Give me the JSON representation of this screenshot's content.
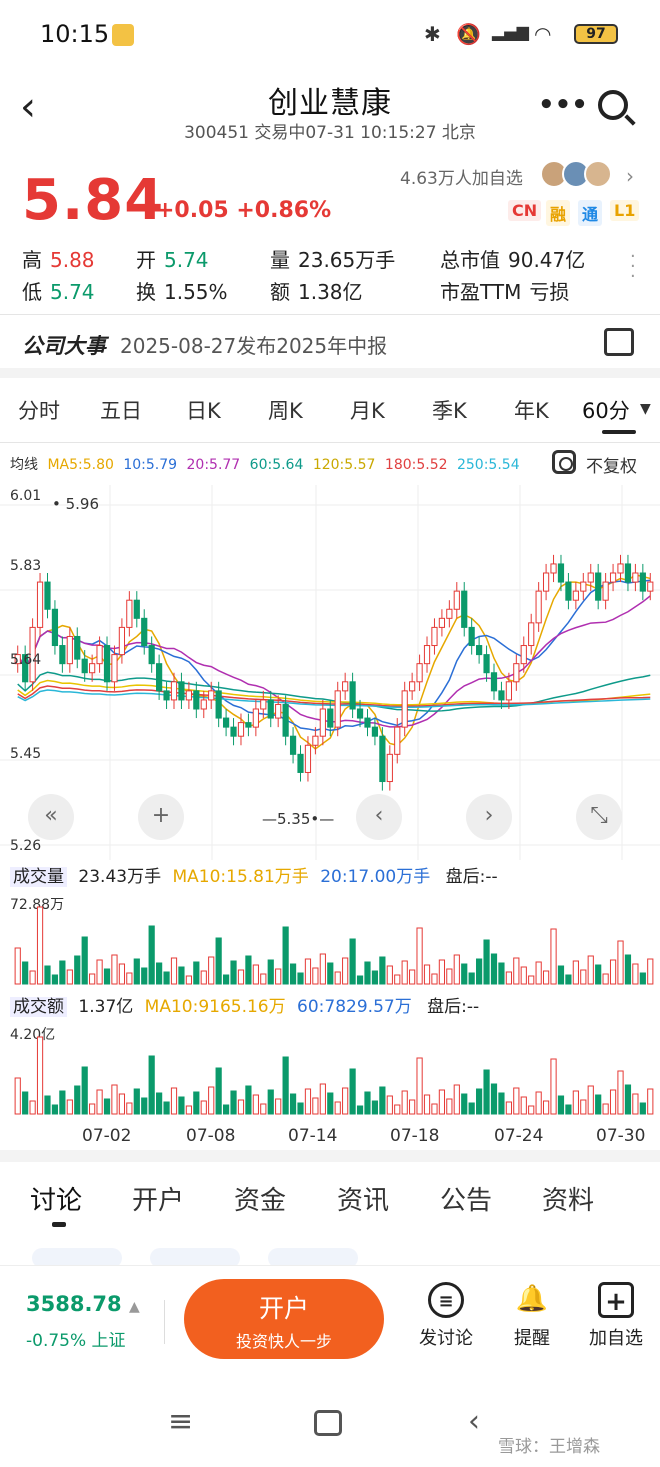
{
  "status_bar": {
    "time": "10:15",
    "battery": "97"
  },
  "header": {
    "title": "创业慧康",
    "subtitle": "300451 交易中07-31 10:15:27 北京"
  },
  "quote": {
    "price": "5.84",
    "change": "+0.05 +0.86%",
    "watch_count": "4.63万人加自选",
    "tags": [
      "CN",
      "融",
      "通",
      "L1"
    ],
    "stats": [
      {
        "label": "高",
        "value": "5.88",
        "color": "red"
      },
      {
        "label": "开",
        "value": "5.74",
        "color": "green"
      },
      {
        "label": "量",
        "value": "23.65万手",
        "color": "plain"
      },
      {
        "label": "总市值",
        "value": "90.47亿",
        "color": "plain"
      },
      {
        "label": "低",
        "value": "5.74",
        "color": "green"
      },
      {
        "label": "换",
        "value": "1.55%",
        "color": "plain"
      },
      {
        "label": "额",
        "value": "1.38亿",
        "color": "plain"
      },
      {
        "label": "市盈TTM",
        "value": "亏损",
        "color": "plain"
      }
    ]
  },
  "event": {
    "title": "公司大事",
    "text": "2025-08-27发布2025年中报"
  },
  "period_tabs": [
    "分时",
    "五日",
    "日K",
    "周K",
    "月K",
    "季K",
    "年K",
    "60分"
  ],
  "ma_legend": [
    {
      "label": "均线",
      "color": "#333333"
    },
    {
      "label": "MA5:5.80",
      "color": "#e6a800"
    },
    {
      "label": "10:5.79",
      "color": "#2b6fd6"
    },
    {
      "label": "20:5.77",
      "color": "#b02fb0"
    },
    {
      "label": "60:5.64",
      "color": "#0e9a8a"
    },
    {
      "label": "120:5.57",
      "color": "#e8c400"
    },
    {
      "label": "180:5.52",
      "color": "#e04040"
    },
    {
      "label": "250:5.54",
      "color": "#2ab7d8"
    }
  ],
  "adjust_label": "不复权",
  "chart_data": {
    "type": "candlestick",
    "y_axis_labels": [
      "6.01",
      "5.83",
      "5.64",
      "5.45",
      "5.26"
    ],
    "ylim": [
      5.26,
      6.01
    ],
    "max_annotation": "5.96",
    "min_annotation": "5.35",
    "x_labels": [
      "07-02",
      "07-08",
      "07-14",
      "07-18",
      "07-24",
      "07-30"
    ],
    "closes": [
      5.68,
      5.62,
      5.74,
      5.84,
      5.78,
      5.7,
      5.66,
      5.72,
      5.67,
      5.64,
      5.66,
      5.7,
      5.62,
      5.68,
      5.74,
      5.8,
      5.76,
      5.7,
      5.66,
      5.6,
      5.58,
      5.62,
      5.58,
      5.6,
      5.56,
      5.58,
      5.6,
      5.54,
      5.52,
      5.5,
      5.53,
      5.52,
      5.56,
      5.58,
      5.54,
      5.57,
      5.5,
      5.46,
      5.42,
      5.48,
      5.5,
      5.56,
      5.52,
      5.6,
      5.62,
      5.56,
      5.54,
      5.52,
      5.5,
      5.4,
      5.46,
      5.52,
      5.6,
      5.62,
      5.66,
      5.7,
      5.74,
      5.76,
      5.78,
      5.82,
      5.74,
      5.7,
      5.68,
      5.64,
      5.6,
      5.58,
      5.62,
      5.66,
      5.7,
      5.75,
      5.82,
      5.86,
      5.88,
      5.84,
      5.8,
      5.82,
      5.84,
      5.86,
      5.8,
      5.84,
      5.86,
      5.88,
      5.84,
      5.86,
      5.82,
      5.84
    ],
    "volume": {
      "title": "成交量",
      "value": "23.43万手",
      "ma10": "MA10:15.81万手",
      "ma20": "20:17.00万手",
      "after": "盘后:--",
      "max_label": "72.88万"
    },
    "amount": {
      "title": "成交额",
      "value": "1.37亿",
      "ma10": "MA10:9165.16万",
      "ma60": "60:7829.57万",
      "after": "盘后:--",
      "max_label": "4.20亿"
    }
  },
  "bottom_tabs": [
    "讨论",
    "开户",
    "资金",
    "资讯",
    "公告",
    "资料"
  ],
  "index": {
    "value": "3588.78",
    "change": "-0.75% 上证"
  },
  "open_button": {
    "title": "开户",
    "subtitle": "投资快人一步"
  },
  "actions": [
    {
      "label": "发讨论",
      "icon": "chat-bubble-icon"
    },
    {
      "label": "提醒",
      "icon": "bell-icon"
    },
    {
      "label": "加自选",
      "icon": "add-square-icon"
    }
  ],
  "watermark": "雪球：王增森"
}
